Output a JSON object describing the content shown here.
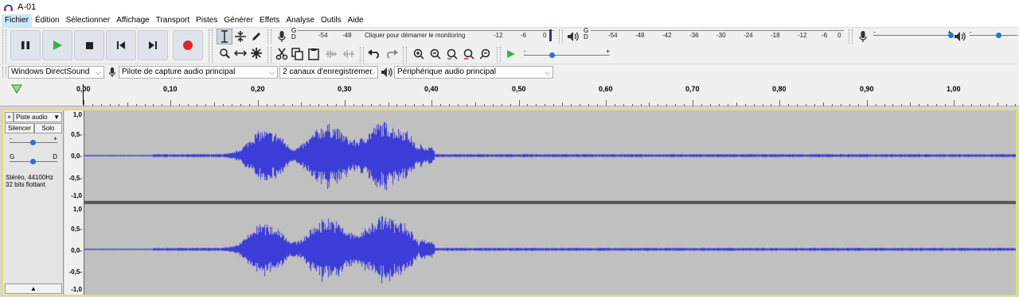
{
  "window": {
    "title": "A-01"
  },
  "menu": [
    "Fichier",
    "Édition",
    "Sélectionner",
    "Affichage",
    "Transport",
    "Pistes",
    "Générer",
    "Effets",
    "Analyse",
    "Outils",
    "Aide"
  ],
  "transport": {
    "pause": "pause-icon",
    "play": "play-icon",
    "stop": "stop-icon",
    "skip_start": "skip-start-icon",
    "skip_end": "skip-end-icon",
    "record": "record-icon"
  },
  "record_meter": {
    "channel_labels": [
      "G",
      "D"
    ],
    "scale": [
      "-54",
      "-48"
    ],
    "prompt": "Cliquer pour démarrer le monitoring",
    "scale_end": [
      "-12",
      "-6",
      "0"
    ]
  },
  "playback_meter": {
    "channel_labels": [
      "G",
      "D"
    ],
    "scale": [
      "-54",
      "-48",
      "-42",
      "-36",
      "-30",
      "-24",
      "-18",
      "-12",
      "-6",
      "0"
    ]
  },
  "slider_marks": {
    "minus": "-",
    "plus": "+"
  },
  "devices": {
    "host": "Windows DirectSound",
    "recording": "Pilote de capture audio principal",
    "channels": "2 canaux d'enregistremer",
    "playback": "Périphérique audio principal"
  },
  "ruler": {
    "labels": [
      "0,00",
      "0,10",
      "0,20",
      "0,30",
      "0,40",
      "0,50",
      "0,60",
      "0,70",
      "0,80",
      "0,90",
      "1,00"
    ]
  },
  "track": {
    "name": "Piste audio",
    "close": "×",
    "mute": "Silencer",
    "solo": "Solo",
    "gain_minus": "-",
    "gain_plus": "+",
    "pan_left": "G",
    "pan_right": "D",
    "info_line1": "Stéréo, 44100Hz",
    "info_line2": "32 bits flottant",
    "amp_labels": [
      "1,0",
      "0,5-",
      "0,0-",
      "-0,5-",
      "-1,0"
    ]
  },
  "colors": {
    "waveform": "#3c3cd8",
    "wave_bg": "#c0c0c0",
    "selection_border": "#e2e060",
    "record_red": "#e0242c",
    "play_green": "#33b54a"
  }
}
